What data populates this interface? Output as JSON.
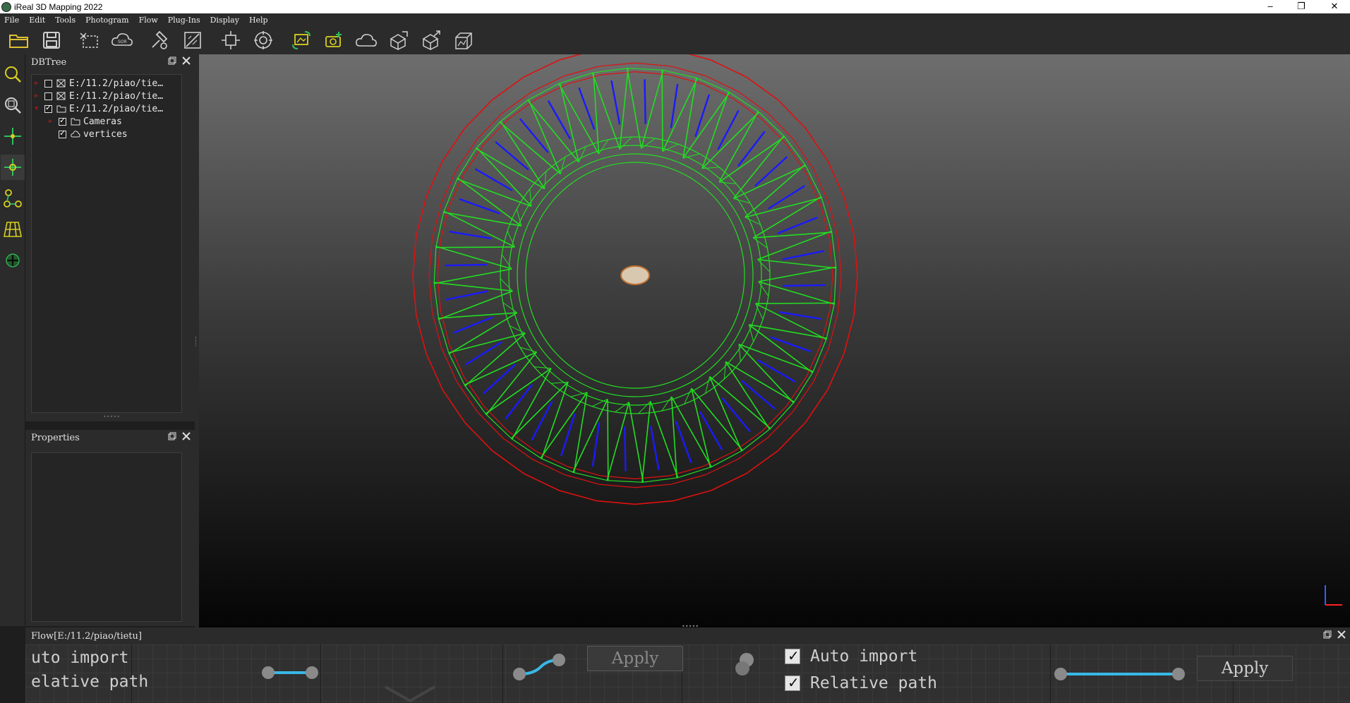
{
  "window": {
    "title": "iReal 3D Mapping 2022",
    "minimize": "–",
    "restore": "❐",
    "close": "✕"
  },
  "menu": [
    "File",
    "Edit",
    "Tools",
    "Photogram",
    "Flow",
    "Plug-Ins",
    "Display",
    "Help"
  ],
  "toolbar_icons": [
    "open-folder-icon",
    "save-icon",
    "crop-icon",
    "sor-cloud-icon",
    "tools-icon",
    "measure-icon",
    "frame-icon",
    "target-icon",
    "photo-sync-icon",
    "camera-add-icon",
    "cloud-icon",
    "export-1-icon",
    "export-2-icon",
    "model-icon"
  ],
  "toolbar_sor_label": "SOR",
  "left_tools": [
    "zoom-icon",
    "zoom-fit-icon",
    "pick-point-icon",
    "pick-center-icon",
    "graph-icon",
    "grid-icon",
    "move-icon"
  ],
  "dbtree": {
    "title": "DBTree",
    "items": [
      {
        "label": "E:/11.2/piao/tie…",
        "checked": false
      },
      {
        "label": "E:/11.2/piao/tie…",
        "checked": false
      },
      {
        "label": "E:/11.2/piao/tie…",
        "checked": true
      },
      {
        "label": "Cameras",
        "checked": true
      },
      {
        "label": "vertices",
        "checked": true
      }
    ]
  },
  "properties": {
    "title": "Properties"
  },
  "flow": {
    "title": "Flow[E:/11.2/piao/tietu]",
    "text_auto_import_cut": "uto import",
    "text_relative_path_cut": "elative path",
    "apply_1": "Apply",
    "auto_import": "Auto import",
    "relative_path": "Relative path",
    "apply_2": "Apply"
  },
  "colors": {
    "bg_panel": "#2b2b2b",
    "camera_green": "#22dd22",
    "frustum_red": "#e01010",
    "ray_blue": "#1a1aff"
  }
}
